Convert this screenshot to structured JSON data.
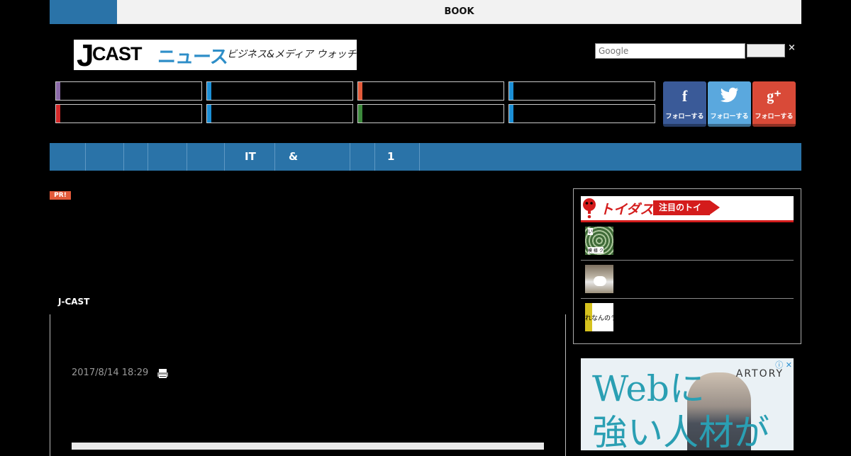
{
  "top_bar": {
    "title": "BOOK"
  },
  "logo": {
    "j": "J",
    "cast": "CAST",
    "news": "ニュース",
    "tagline": "ビジネス&メディア ウォッチ"
  },
  "search": {
    "placeholder": "Google",
    "close": "×"
  },
  "categories": [
    {
      "color": "#8b6aa8"
    },
    {
      "color": "#1c8fd6"
    },
    {
      "color": "#e25a3a"
    },
    {
      "color": "#1c8fd6"
    },
    {
      "color": "#d42a2a"
    },
    {
      "color": "#1c8fd6"
    },
    {
      "color": "#3d8a3d"
    },
    {
      "color": "#1c8fd6"
    }
  ],
  "social": [
    {
      "glyph": "f",
      "label": "フォローする",
      "color": "#3a5a98"
    },
    {
      "glyph": "t",
      "label": "フォローする",
      "color": "#5aa8de"
    },
    {
      "glyph": "g⁺",
      "label": "フォローする",
      "color": "#d94a38"
    }
  ],
  "nav": {
    "items": [
      "IT",
      "&",
      "1"
    ]
  },
  "pr_badge": "PR!",
  "article": {
    "source": "J-CAST",
    "date": "2017/8/14 18:29"
  },
  "sidebar": {
    "toigusu": {
      "name": "トイダス",
      "badge": "注目のトイ"
    },
    "thumb_text_1": "い",
    "thumb_text_1b": "模 様 ク",
    "thumb_text_3": "れなんのラ"
  },
  "ad": {
    "brand": "ARTORY",
    "headline_line1": "Webに",
    "headline_line2": "強い人材が",
    "close": "ⓘ ✕"
  }
}
